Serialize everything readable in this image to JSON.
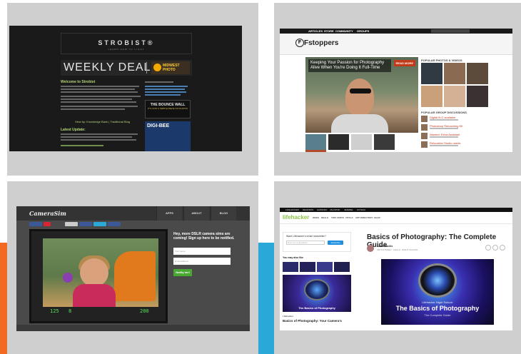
{
  "accent_colors": {
    "orange": "#f26a21",
    "blue": "#2aa9d8",
    "tile_bg": "#cfcfcf"
  },
  "strobist": {
    "logo": "STROBIST®",
    "tagline": "LEARN HOW TO LIGHT",
    "deals": "WEEKLY DEALS",
    "sponsor": "MIDWEST PHOTO",
    "welcome": "Welcome to Strobist",
    "kb_links": "View by: Knowledge Bank | Traditional Blog",
    "latest": "Latest Update:",
    "bounce_wall": "THE BOUNCE WALL",
    "bounce_sub": "IT'S JUST A SIMPLE PIECE OF PLASTIC",
    "ad_brand": "DIGI-BEE"
  },
  "fstoppers": {
    "nav": [
      "ARTICLES",
      "STORE",
      "COMMUNITY",
      "GROUPS"
    ],
    "logo": "Fstoppers",
    "hero_title": "Keeping Your Passion for Photography Alive When You're Doing It Full-Time",
    "read_more": "READ MORE",
    "popular_photos": "POPULAR PHOTOS & VIDEOS",
    "popular_groups": "POPULAR GROUP DISCUSSIONS",
    "discussions": [
      "Digital B-O available",
      "Photoshop Retouching Kit",
      "Wanted: Extra Assistant",
      "Relocation Studio needs"
    ]
  },
  "camerasim": {
    "logo": "CameraSim",
    "tabs": [
      "APPS",
      "ABOUT",
      "BLOG"
    ],
    "panel_text": "Hey, more DSLR camera sims are coming! Sign up here to be notified.",
    "name_placeholder": "Your name",
    "email_placeholder": "Email address",
    "notify_button": "Notify me!",
    "readout": [
      "125",
      "8",
      "200"
    ]
  },
  "lifehacker": {
    "topbar": [
      "LIFEHACKER",
      "DEADSPIN",
      "GIZMODO",
      "JALOPNIK",
      "JEZEBEL",
      "KOTAKU"
    ],
    "logo": "lifehacker",
    "nav": [
      "WEEK",
      "DEALS",
      "TWO CENTS",
      "VITALS",
      "APP DIRECTORY",
      "GEAR"
    ],
    "newsletter_label": "Want Lifehacker's email newsletter?",
    "newsletter_placeholder": "Enter your email address",
    "subscribe": "Subscribe",
    "may_also_like": "You may also like",
    "side_caption": "The Basics of Photography",
    "side_source": "Lifehacker",
    "side_title": "Basics of Photography: Your Camera's",
    "article_title": "Basics of Photography: The Complete Guide",
    "author": "Adam Dachis",
    "meta": "4/07/13 8:00am · Filed to: NIGHT SCHOOL",
    "hero_line1": "Lifehacker Night School:",
    "hero_line2": "The Basics of Photography",
    "hero_line3": "The Complete Guide"
  }
}
